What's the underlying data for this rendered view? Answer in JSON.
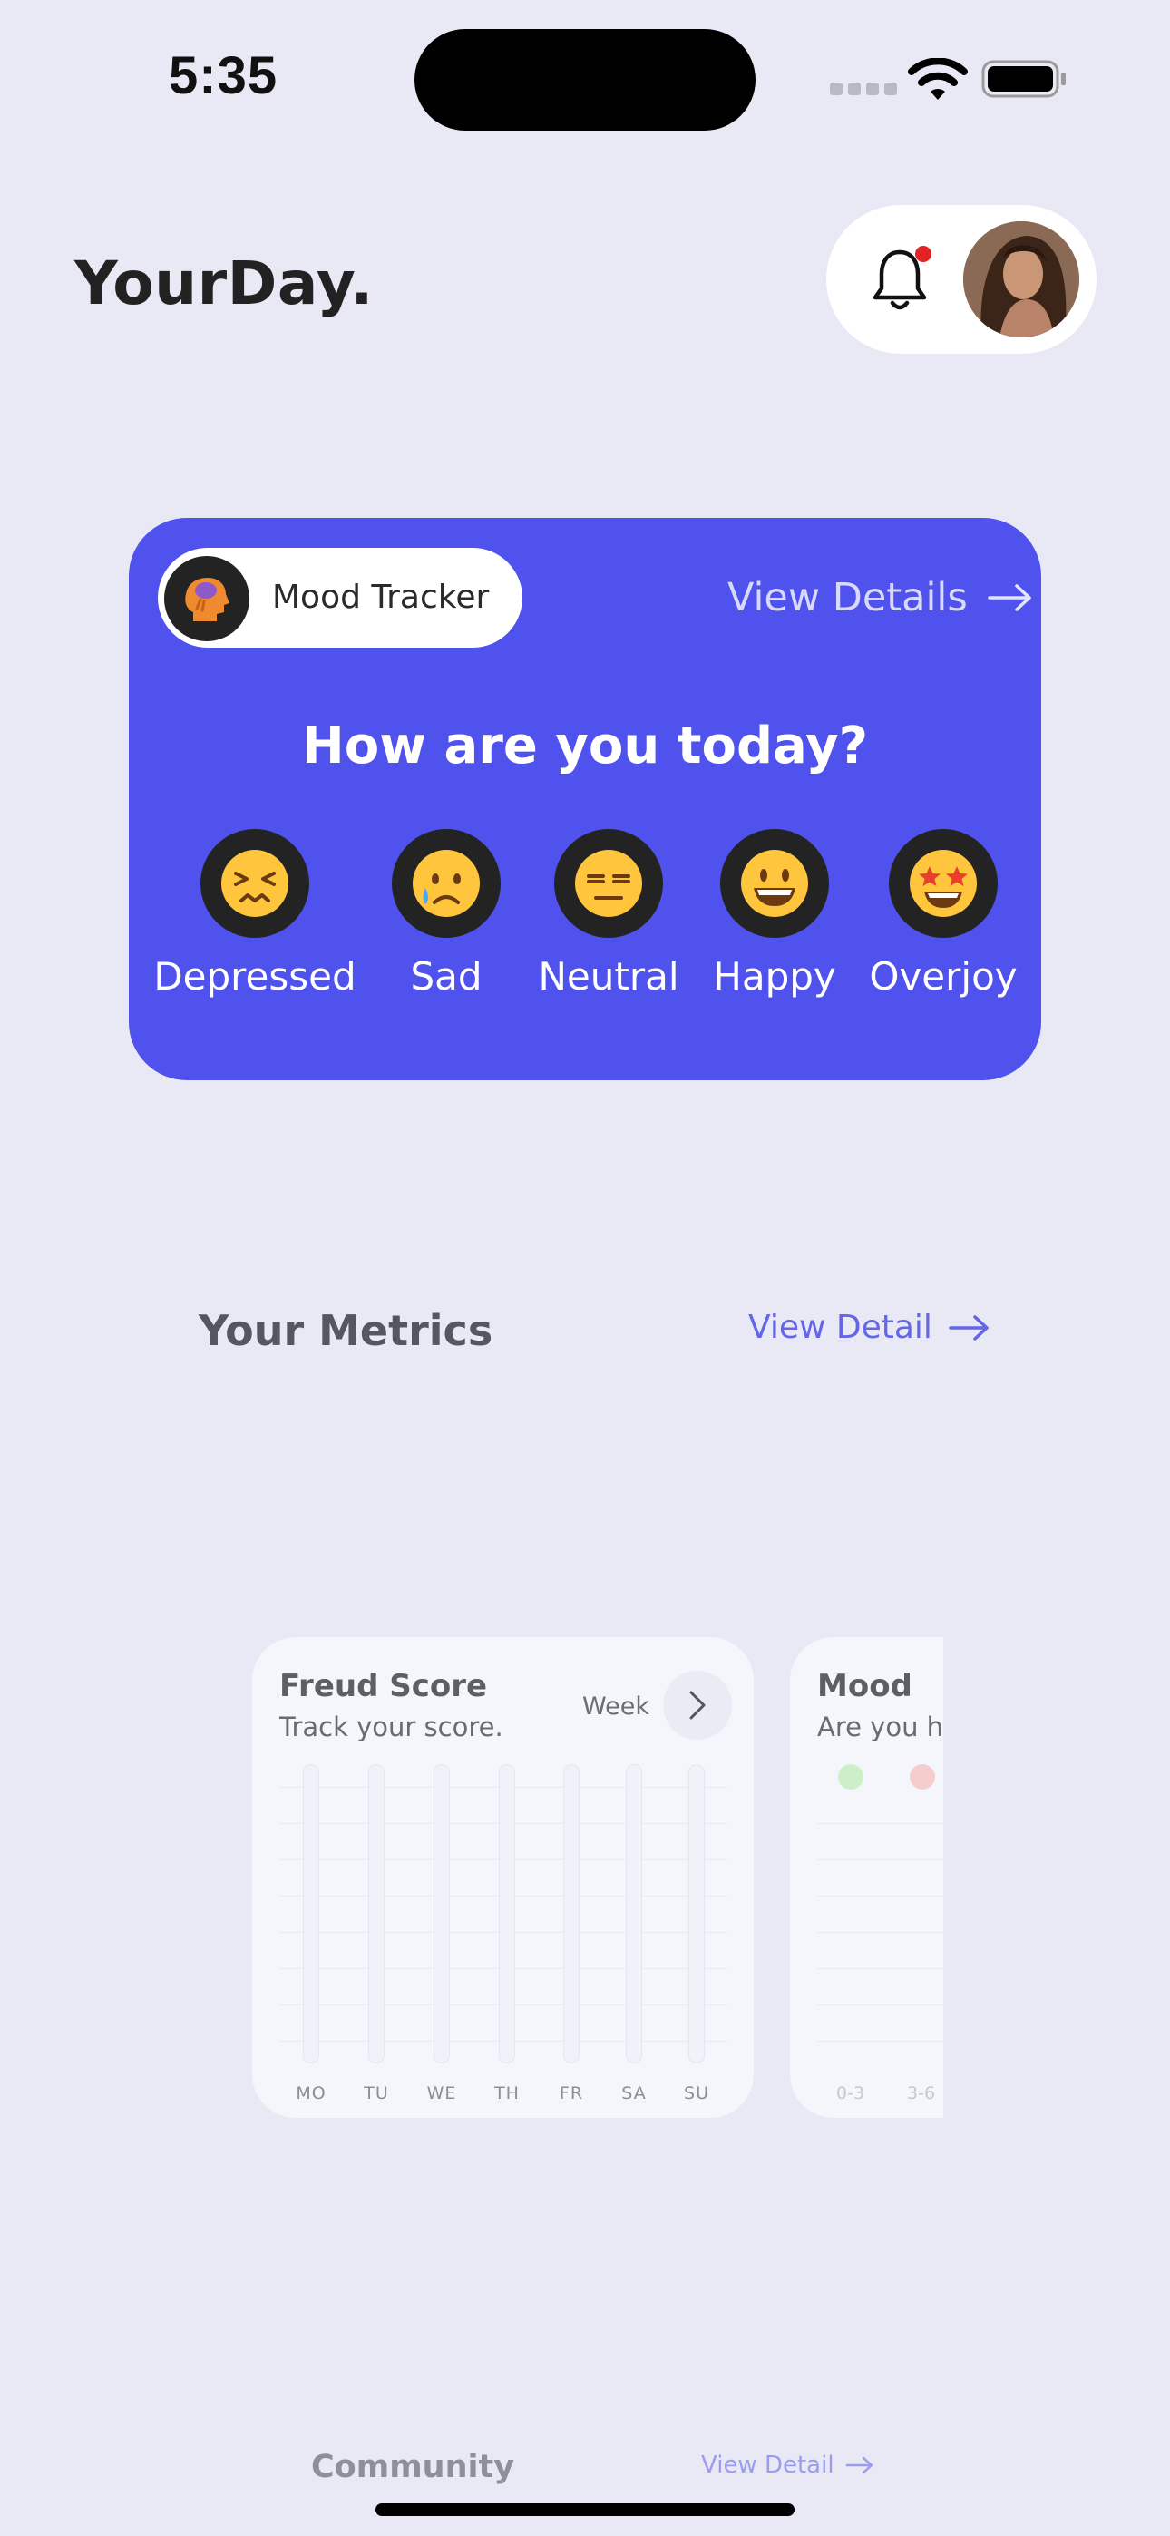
{
  "status_bar": {
    "time": "5:35"
  },
  "header": {
    "app_title": "YourDay."
  },
  "mood_card": {
    "tracker_label": "Mood Tracker",
    "view_details": "View Details",
    "question": "How are you today?",
    "moods": [
      {
        "label": "Depressed",
        "emoji": "😣"
      },
      {
        "label": "Sad",
        "emoji": "😢"
      },
      {
        "label": "Neutral",
        "emoji": "😑"
      },
      {
        "label": "Happy",
        "emoji": "😀"
      },
      {
        "label": "Overjoy",
        "emoji": "🤩"
      }
    ]
  },
  "metrics": {
    "title": "Your Metrics",
    "view_detail": "View Detail",
    "freud_card": {
      "title": "Freud Score",
      "subtitle": "Track your score.",
      "period": "Week",
      "days": [
        "MO",
        "TU",
        "WE",
        "TH",
        "FR",
        "SA",
        "SU"
      ]
    },
    "mood_card": {
      "title": "Mood",
      "subtitle": "Are you ha",
      "ranges": [
        "0-3",
        "3-6"
      ]
    }
  },
  "community": {
    "title": "Community",
    "view_detail": "View Detail"
  },
  "colors": {
    "background": "#E8E9F5",
    "accent": "#4F52ED",
    "link": "#6366E6",
    "dark": "#232323"
  }
}
